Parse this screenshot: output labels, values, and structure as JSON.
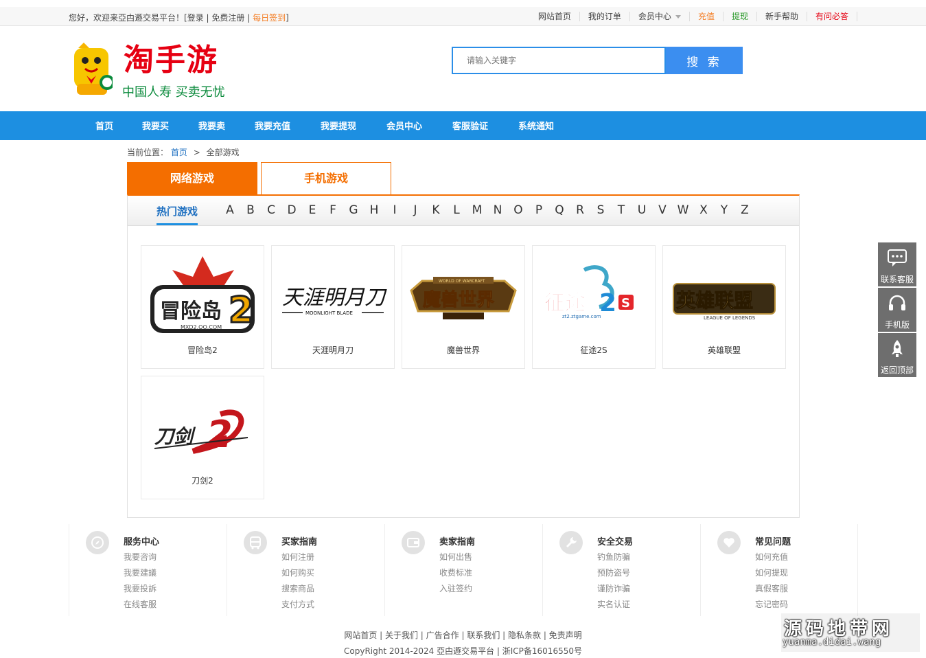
{
  "topbar": {
    "welcome": "您好，欢迎来亞甴遯交易平台！[",
    "login": "登录",
    "sep": " | ",
    "register": "免费注册",
    "sign": "每日签到",
    "end": "]",
    "nav": [
      "网站首页",
      "我的订单",
      "会员中心",
      "充值",
      "提现",
      "新手帮助",
      "有问必答"
    ],
    "nav_colors": [
      "#444444",
      "#444444",
      "#444444",
      "#f47b20",
      "#2a9a2a",
      "#444444",
      "#e60012"
    ]
  },
  "logo": {
    "brand": "淘手游",
    "slogan": "中国人寿 买卖无忧"
  },
  "search": {
    "placeholder": "请输入关键字",
    "button": "搜 索"
  },
  "mainnav": [
    "首页",
    "我要买",
    "我要卖",
    "我要充值",
    "我要提现",
    "会员中心",
    "客服验证",
    "系统通知"
  ],
  "breadcrumb": {
    "label": "当前位置：",
    "home": "首页",
    "sep": ">",
    "current": "全部游戏"
  },
  "tabs": [
    "网络游戏",
    "手机游戏"
  ],
  "letters": {
    "hot": "热门游戏",
    "list": [
      "A",
      "B",
      "C",
      "D",
      "E",
      "F",
      "G",
      "H",
      "I",
      "J",
      "K",
      "L",
      "M",
      "N",
      "O",
      "P",
      "Q",
      "R",
      "S",
      "T",
      "U",
      "V",
      "W",
      "X",
      "Y",
      "Z"
    ]
  },
  "games": [
    {
      "name": "冒险岛2",
      "logo_text": "冒险岛2",
      "logo_sub": "MXD2.QQ.COM"
    },
    {
      "name": "天涯明月刀",
      "logo_text": "天涯明月刀",
      "logo_sub": "MOONLIGHT BLADE"
    },
    {
      "name": "魔兽世界",
      "logo_text": "魔兽世界",
      "logo_sub": "WORLD OF WARCRAFT"
    },
    {
      "name": "征途2S",
      "logo_text": "征途2S",
      "logo_sub": "zt2.ztgame.com"
    },
    {
      "name": "英雄联盟",
      "logo_text": "英雄联盟",
      "logo_sub": "LEAGUE OF LEGENDS"
    },
    {
      "name": "刀剑2",
      "logo_text": "刀剑2",
      "logo_sub": ""
    }
  ],
  "side": [
    "联系客服",
    "手机版",
    "返回顶部"
  ],
  "footer": {
    "columns": [
      {
        "title": "服务中心",
        "icon": "compass-icon",
        "links": [
          "我要咨询",
          "我要建議",
          "我要投訴",
          "在线客服"
        ]
      },
      {
        "title": "买家指南",
        "icon": "bus-icon",
        "links": [
          "如何注册",
          "如何购买",
          "搜索商品",
          "支付方式"
        ]
      },
      {
        "title": "卖家指南",
        "icon": "wallet-icon",
        "links": [
          "如何出售",
          "收费标准",
          "入驻签约"
        ]
      },
      {
        "title": "安全交易",
        "icon": "wrench-icon",
        "links": [
          "钓鱼防骗",
          "预防盗号",
          "谨防诈骗",
          "实名认证"
        ]
      },
      {
        "title": "常见问题",
        "icon": "heart-icon",
        "links": [
          "如何充值",
          "如何提现",
          "真假客服",
          "忘记密码"
        ]
      }
    ],
    "links": "网站首页 | 关于我们 | 广告合作 | 联系我们 | 隐私条款 | 免责声明",
    "copyright": "CopyRight 2014-2024 亞甴遯交易平台 | 浙ICP备16016550号"
  },
  "watermark": {
    "big": "源码地带网",
    "small": "yuanma.didai.wang"
  }
}
